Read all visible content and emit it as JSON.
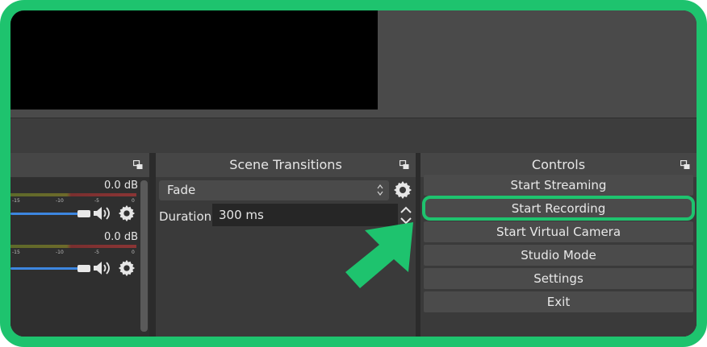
{
  "mixer": {
    "channels": [
      {
        "db": "0.0 dB",
        "ticks": [
          "-15",
          "-10",
          "-5",
          "0"
        ],
        "volume_fraction": 0.96
      },
      {
        "db": "0.0 dB",
        "ticks": [
          "-15",
          "-10",
          "-5",
          "0"
        ],
        "volume_fraction": 0.96
      }
    ]
  },
  "transitions": {
    "title": "Scene Transitions",
    "selected": "Fade",
    "duration_label": "Duration",
    "duration_value": "300 ms"
  },
  "controls": {
    "title": "Controls",
    "buttons": [
      "Start Streaming",
      "Start Recording",
      "Start Virtual Camera",
      "Studio Mode",
      "Settings",
      "Exit"
    ],
    "highlighted_index": 1
  },
  "colors": {
    "highlight": "#1ec36e",
    "slider": "#3d86e0",
    "panel": "#3a3a3a",
    "title_bar": "#464646",
    "button": "#4b4b4b"
  },
  "icons": [
    "float-dock-icon",
    "speaker-icon",
    "gear-icon",
    "spin-arrows-icon",
    "chevron-up-icon",
    "chevron-down-icon",
    "pointer-arrow-icon"
  ]
}
